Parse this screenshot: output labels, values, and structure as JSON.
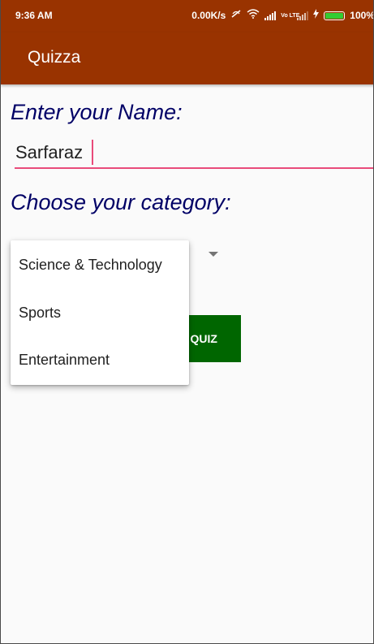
{
  "status_bar": {
    "time": "9:36 AM",
    "net_speed": "0.00K/s",
    "lte_label": "Vo LTE",
    "battery_percent": "100%",
    "battery_level": 1.0
  },
  "app_bar": {
    "title": "Quizza"
  },
  "form": {
    "name_label": "Enter your Name:",
    "name_value": "Sarfaraz",
    "category_label": "Choose your category:",
    "start_button_label": "START QUIZ"
  },
  "dropdown": {
    "options": [
      "Science & Technology",
      "Sports",
      "Entertainment"
    ]
  },
  "colors": {
    "primary": "#993300",
    "label_text": "#000066",
    "accent": "#e94b7a",
    "button": "#006600"
  },
  "icons": {
    "status": [
      "data-saver-icon",
      "wifi-icon",
      "signal-icon",
      "lte-icon",
      "signal-icon",
      "charging-icon",
      "battery-icon"
    ],
    "spinner": "dropdown-arrow-icon"
  }
}
